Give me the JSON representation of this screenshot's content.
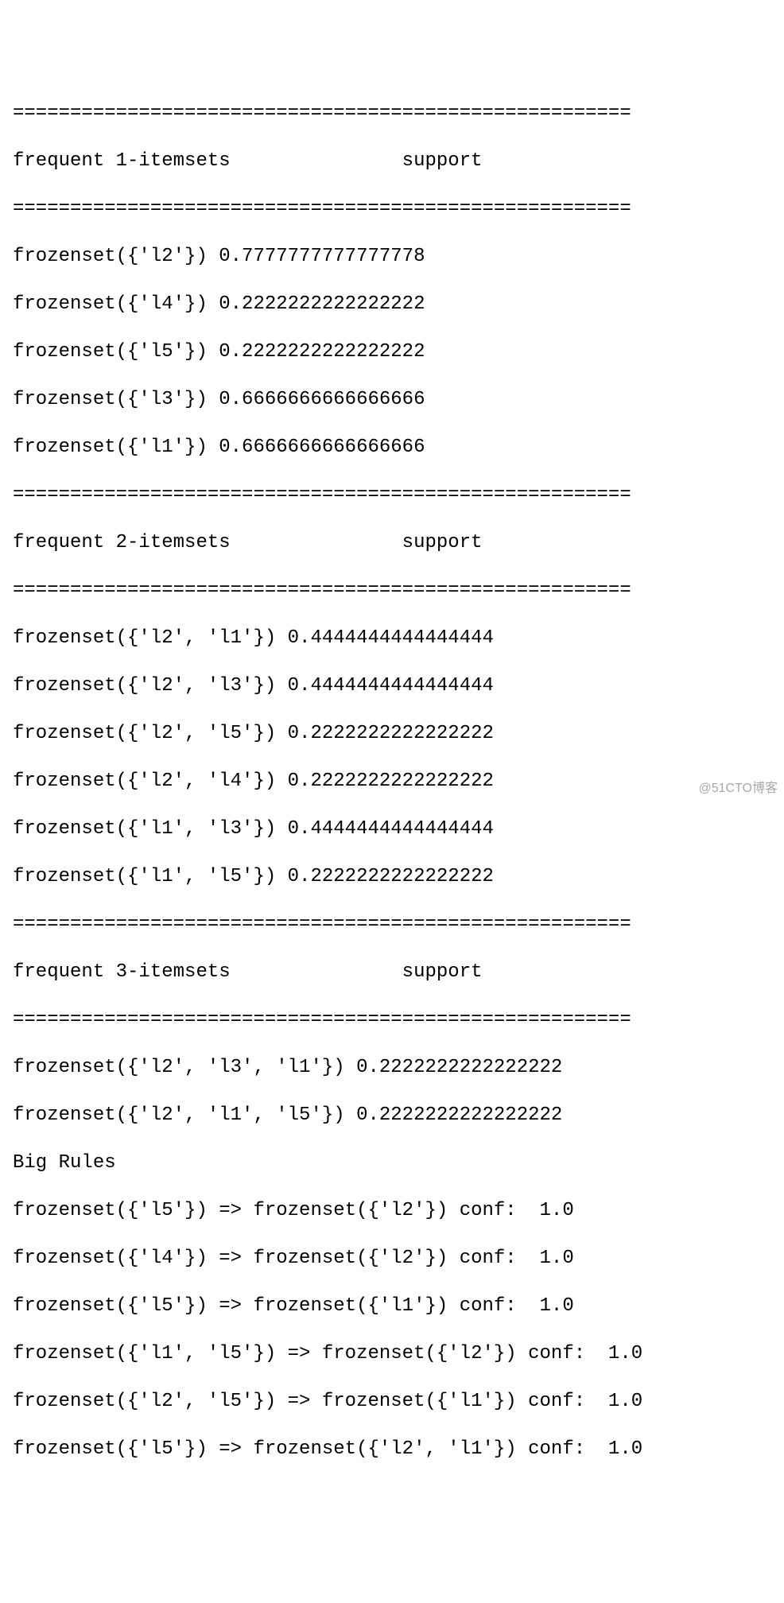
{
  "separator": "======================================================",
  "sections": {
    "s1": {
      "header": "frequent 1-itemsets               support",
      "rows": [
        "frozenset({'l2'}) 0.7777777777777778",
        "frozenset({'l4'}) 0.2222222222222222",
        "frozenset({'l5'}) 0.2222222222222222",
        "frozenset({'l3'}) 0.6666666666666666",
        "frozenset({'l1'}) 0.6666666666666666"
      ]
    },
    "s2": {
      "header": "frequent 2-itemsets               support",
      "rows": [
        "frozenset({'l2', 'l1'}) 0.4444444444444444",
        "frozenset({'l2', 'l3'}) 0.4444444444444444",
        "frozenset({'l2', 'l5'}) 0.2222222222222222",
        "frozenset({'l2', 'l4'}) 0.2222222222222222",
        "frozenset({'l1', 'l3'}) 0.4444444444444444",
        "frozenset({'l1', 'l5'}) 0.2222222222222222"
      ]
    },
    "s3": {
      "header": "frequent 3-itemsets               support",
      "rows": [
        "frozenset({'l2', 'l3', 'l1'}) 0.2222222222222222",
        "frozenset({'l2', 'l1', 'l5'}) 0.2222222222222222"
      ]
    }
  },
  "rules": {
    "title": "Big Rules",
    "rows": [
      "frozenset({'l5'}) => frozenset({'l2'}) conf:  1.0",
      "frozenset({'l4'}) => frozenset({'l2'}) conf:  1.0",
      "frozenset({'l5'}) => frozenset({'l1'}) conf:  1.0",
      "frozenset({'l1', 'l5'}) => frozenset({'l2'}) conf:  1.0",
      "frozenset({'l2', 'l5'}) => frozenset({'l1'}) conf:  1.0",
      "frozenset({'l5'}) => frozenset({'l2', 'l1'}) conf:  1.0"
    ]
  },
  "watermark": "@51CTO博客"
}
